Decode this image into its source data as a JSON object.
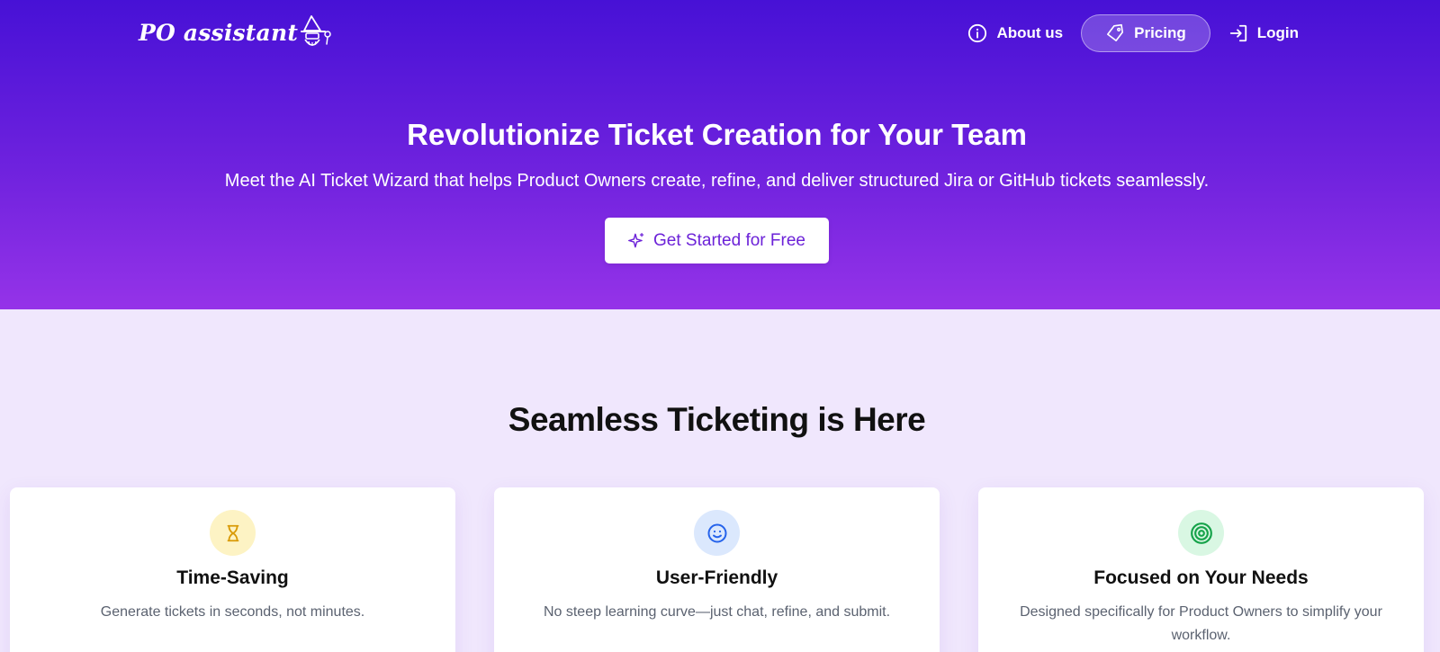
{
  "brand": {
    "name": "PO assistant"
  },
  "nav": {
    "about_label": "About us",
    "pricing_label": "Pricing",
    "login_label": "Login"
  },
  "hero": {
    "title": "Revolutionize Ticket Creation for Your Team",
    "subtitle": "Meet the AI Ticket Wizard that helps Product Owners create, refine, and deliver structured Jira or GitHub tickets seamlessly.",
    "cta_label": "Get Started for Free"
  },
  "features": {
    "title": "Seamless Ticketing is Here",
    "cards": [
      {
        "icon": "hourglass-icon",
        "title": "Time-Saving",
        "description": "Generate tickets in seconds, not minutes.",
        "icon_color": "#d99a06",
        "icon_bg": "#fdf3c4"
      },
      {
        "icon": "smiley-icon",
        "title": "User-Friendly",
        "description": "No steep learning curve—just chat, refine, and submit.",
        "icon_color": "#2563eb",
        "icon_bg": "#dbe8fd"
      },
      {
        "icon": "target-icon",
        "title": "Focused on Your Needs",
        "description": "Designed specifically for Product Owners to simplify your workflow.",
        "icon_color": "#16a34a",
        "icon_bg": "#d9f7e3"
      }
    ]
  },
  "colors": {
    "hero_gradient_top": "#4711d6",
    "hero_gradient_bottom": "#9533e8",
    "accent": "#6c22d8",
    "page_background": "#f0e7fd"
  }
}
